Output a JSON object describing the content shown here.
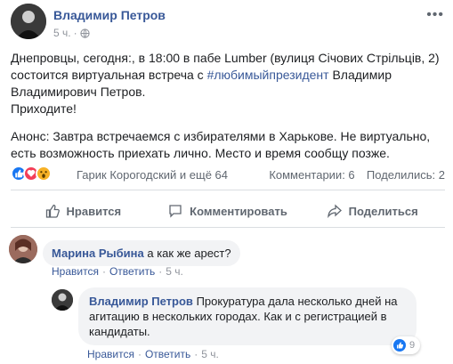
{
  "post": {
    "author": "Владимир Петров",
    "time": "5 ч.",
    "paragraph1_a": "Днепровцы, сегодня:, в 18:00 в пабе Lumber (вулиця Січових Стрільців, 2) состоится виртуальная встреча с ",
    "hashtag": "#любимыйпрезидент",
    "paragraph1_b": " Владимир Владимирович Петров.",
    "paragraph2": "Приходите!",
    "paragraph3": "Анонс: Завтра встречаемся с избирателями в Харькове. Не виртуально, есть возможность приехать лично. Место и время сообщу позже."
  },
  "reactions": {
    "icons": [
      "like-icon",
      "love-icon",
      "wow-icon"
    ],
    "reactors": "Гарик Корогодский и ещё 64",
    "comments": "Комментарии: 6",
    "shares": "Поделились: 2"
  },
  "actions": {
    "like": "Нравится",
    "comment": "Комментировать",
    "share": "Поделиться"
  },
  "comments": [
    {
      "author": "Марина Рыбина",
      "text": "а как же арест?",
      "like": "Нравится",
      "reply": "Ответить",
      "time": "5 ч."
    },
    {
      "author": "Владимир Петров",
      "text": "Прокуратура дала несколько дней на агитацию в нескольких городах. Как и с регистрацией в кандидаты.",
      "like": "Нравится",
      "reply": "Ответить",
      "time": "5 ч.",
      "likes_count": "9"
    }
  ],
  "separator": "·"
}
